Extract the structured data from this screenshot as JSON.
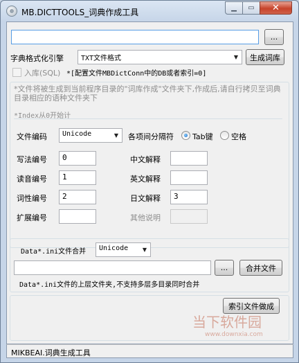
{
  "window": {
    "title": "MB.DICTTOOLS_词典作成工具",
    "close_glyph": "✕",
    "max_glyph": "▭",
    "min_glyph": "▁"
  },
  "top": {
    "path_value": "",
    "browse_label": "...",
    "format_label": "字典格式化引擎",
    "format_value": "TXT文件格式",
    "generate_label": "生成词库",
    "import_label": "入库(SQL)",
    "import_note": "*[配置文件MBDictConn中的DB或者索引=0]"
  },
  "info": {
    "note": "*文件将被生成到当前程序目录的\"词库作成\"文件夹下,作成后,请自行拷贝至词典目录相应的语种文件夹下",
    "index_note": "*Index从0开始计"
  },
  "encoding": {
    "label": "文件编码",
    "value": "Unicode",
    "separator_label": "各项间分隔符",
    "tab_label": "Tab键",
    "space_label": "空格"
  },
  "fields": {
    "writing_label": "写法编号",
    "writing_value": "0",
    "reading_label": "读音编号",
    "reading_value": "1",
    "pos_label": "词性编号",
    "pos_value": "2",
    "ext_label": "扩展编号",
    "ext_value": "",
    "cn_label": "中文解释",
    "cn_value": "",
    "en_label": "英文解释",
    "en_value": "",
    "jp_label": "日文解释",
    "jp_value": "3",
    "other_label": "其他说明",
    "other_value": ""
  },
  "merge": {
    "label": "Data*.ini文件合并",
    "encoding_value": "Unicode",
    "path_value": "",
    "browse_label": "...",
    "merge_label": "合并文件",
    "note": "Data*.ini文件的上层文件夹,不支持多层多目录同时合并"
  },
  "index": {
    "button_label": "索引文件做成"
  },
  "status": {
    "text": "MIKBEAI.词典生成工具"
  },
  "watermark": {
    "text": "当下软件园",
    "url": "www.downxia.com"
  }
}
